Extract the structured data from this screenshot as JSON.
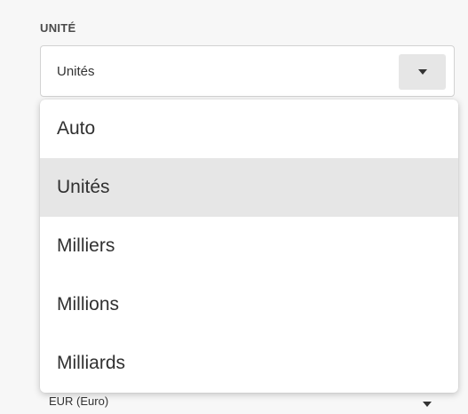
{
  "unit_field": {
    "label": "UNITÉ",
    "selected_value": "Unités",
    "options": [
      {
        "label": "Auto",
        "selected": false
      },
      {
        "label": "Unités",
        "selected": true
      },
      {
        "label": "Milliers",
        "selected": false
      },
      {
        "label": "Millions",
        "selected": false
      },
      {
        "label": "Milliards",
        "selected": false
      }
    ]
  },
  "currency_field": {
    "selected_value": "EUR (Euro)"
  },
  "icons": {
    "select_caret": "chevron-down-icon"
  }
}
